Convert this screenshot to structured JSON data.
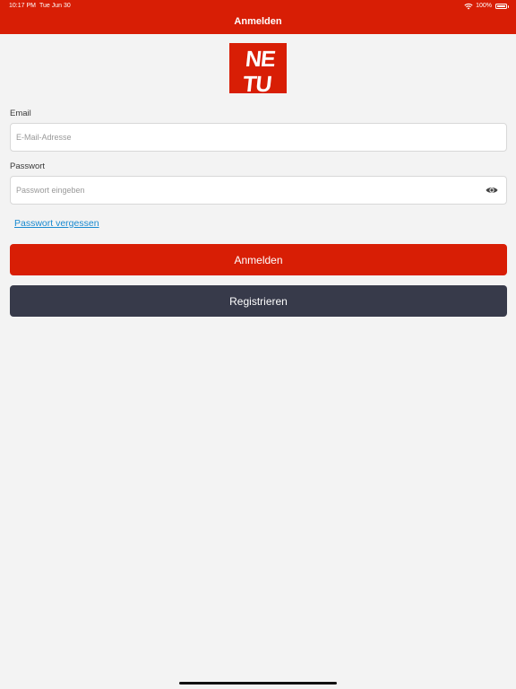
{
  "status_bar": {
    "time": "10:17 PM",
    "date": "Tue Jun 30",
    "battery": "100%"
  },
  "nav": {
    "title": "Anmelden"
  },
  "logo": {
    "lines": [
      "NE",
      "TU"
    ],
    "color": "#d81e05"
  },
  "form": {
    "email_label": "Email",
    "email_placeholder": "E-Mail-Adresse",
    "email_value": "",
    "password_label": "Passwort",
    "password_placeholder": "Passwort eingeben",
    "password_value": "",
    "forgot_link": "Passwort vergessen",
    "login_button": "Anmelden",
    "register_button": "Registrieren"
  },
  "colors": {
    "brand_red": "#d81e05",
    "dark_button": "#373a4a",
    "link": "#1a8ad0",
    "background": "#f3f3f3"
  }
}
